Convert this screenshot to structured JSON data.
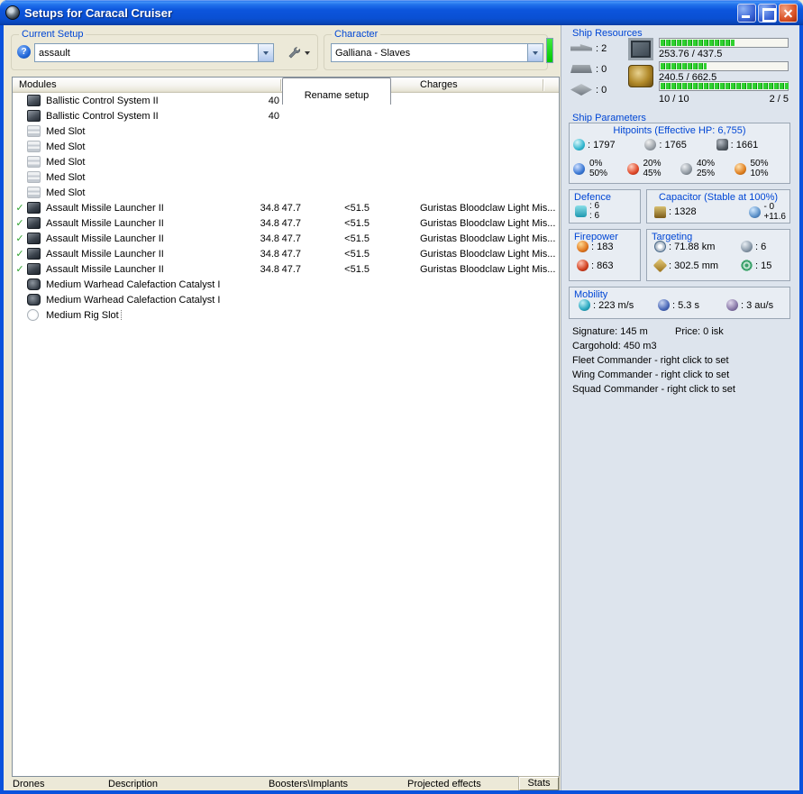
{
  "window": {
    "title": "Setups for Caracal Cruiser"
  },
  "current_setup": {
    "label": "Current Setup",
    "help_glyph": "?",
    "value": "assault"
  },
  "character": {
    "label": "Character",
    "value": "Galliana - Slaves"
  },
  "ship_resources": {
    "label": "Ship Resources",
    "hardpoints": [
      {
        "type": "turret",
        "value": ": 2"
      },
      {
        "type": "launcher",
        "value": ": 0"
      },
      {
        "type": "rig",
        "value": ": 0"
      }
    ],
    "cpu": {
      "text": "253.76 / 437.5",
      "fill": "width:58%"
    },
    "powergrid": {
      "text": "240.5 / 662.5",
      "fill": "width:36%"
    },
    "calibration": {
      "text": "10 / 10",
      "fill": "width:100%"
    },
    "drones": {
      "text": "2 / 5"
    }
  },
  "modules": {
    "column_header": "Modules",
    "tab_rename": "Rename setup",
    "tab_charges": "Charges",
    "rows": [
      {
        "check": "",
        "icon": "i-filled",
        "name": "Ballistic Control System II",
        "v1": "40",
        "v2": "",
        "v3": "",
        "charge": "",
        "row_class": ""
      },
      {
        "check": "",
        "icon": "i-filled",
        "name": "Ballistic Control System II",
        "v1": "40",
        "v2": "",
        "v3": "",
        "charge": "",
        "row_class": ""
      },
      {
        "check": "",
        "icon": "i-empty",
        "name": "Med Slot",
        "v1": "",
        "v2": "",
        "v3": "",
        "charge": "",
        "row_class": ""
      },
      {
        "check": "",
        "icon": "i-empty",
        "name": "Med Slot",
        "v1": "",
        "v2": "",
        "v3": "",
        "charge": "",
        "row_class": ""
      },
      {
        "check": "",
        "icon": "i-empty",
        "name": "Med Slot",
        "v1": "",
        "v2": "",
        "v3": "",
        "charge": "",
        "row_class": ""
      },
      {
        "check": "",
        "icon": "i-empty",
        "name": "Med Slot",
        "v1": "",
        "v2": "",
        "v3": "",
        "charge": "",
        "row_class": ""
      },
      {
        "check": "",
        "icon": "i-empty",
        "name": "Med Slot",
        "v1": "",
        "v2": "",
        "v3": "",
        "charge": "",
        "row_class": ""
      },
      {
        "check": "✓",
        "icon": "i-launcher",
        "name": "Assault Missile Launcher II",
        "v1": "34.8",
        "v2": "47.7",
        "v3": "<51.5",
        "charge": "Guristas Bloodclaw Light Mis...",
        "row_class": ""
      },
      {
        "check": "✓",
        "icon": "i-launcher",
        "name": "Assault Missile Launcher II",
        "v1": "34.8",
        "v2": "47.7",
        "v3": "<51.5",
        "charge": "Guristas Bloodclaw Light Mis...",
        "row_class": ""
      },
      {
        "check": "✓",
        "icon": "i-launcher",
        "name": "Assault Missile Launcher II",
        "v1": "34.8",
        "v2": "47.7",
        "v3": "<51.5",
        "charge": "Guristas Bloodclaw Light Mis...",
        "row_class": ""
      },
      {
        "check": "✓",
        "icon": "i-launcher",
        "name": "Assault Missile Launcher II",
        "v1": "34.8",
        "v2": "47.7",
        "v3": "<51.5",
        "charge": "Guristas Bloodclaw Light Mis...",
        "row_class": ""
      },
      {
        "check": "✓",
        "icon": "i-launcher",
        "name": "Assault Missile Launcher II",
        "v1": "34.8",
        "v2": "47.7",
        "v3": "<51.5",
        "charge": "Guristas Bloodclaw Light Mis...",
        "row_class": ""
      },
      {
        "check": "",
        "icon": "i-rig",
        "name": "Medium Warhead Calefaction Catalyst I",
        "v1": "",
        "v2": "",
        "v3": "",
        "charge": "",
        "row_class": ""
      },
      {
        "check": "",
        "icon": "i-rig",
        "name": "Medium Warhead Calefaction Catalyst I",
        "v1": "",
        "v2": "",
        "v3": "",
        "charge": "",
        "row_class": ""
      },
      {
        "check": "",
        "icon": "i-rigslot",
        "name": "Medium Rig Slot",
        "v1": "",
        "v2": "",
        "v3": "",
        "charge": "",
        "row_class": "sel"
      }
    ]
  },
  "ship_parameters": {
    "label": "Ship Parameters",
    "hitpoints": {
      "title": "Hitpoints (Effective HP: 6,755)",
      "shield": ": 1797",
      "armor": ": 1765",
      "structure": ": 1661",
      "resists": [
        {
          "type": "em",
          "top": "0%",
          "bottom": "50%"
        },
        {
          "type": "thermal",
          "top": "20%",
          "bottom": "45%"
        },
        {
          "type": "kinetic",
          "top": "40%",
          "bottom": "25%"
        },
        {
          "type": "explosive",
          "top": "50%",
          "bottom": "10%"
        }
      ]
    },
    "defence": {
      "title": "Defence",
      "line1": ": 6",
      "line2": ": 6"
    },
    "capacitor": {
      "title": "Capacitor (Stable at 100%)",
      "amount": ": 1328",
      "delta_minus": "- 0",
      "delta_plus": "+11.6"
    },
    "firepower": {
      "title": "Firepower",
      "dps": ": 183",
      "volley": ": 863"
    },
    "targeting": {
      "title": "Targeting",
      "range": ": 71.88 km",
      "max_targets": ": 6",
      "scan_resolution": ": 302.5 mm",
      "sensor_strength": ": 15"
    },
    "mobility": {
      "title": "Mobility",
      "speed": ": 223 m/s",
      "agility": ": 5.3 s",
      "warp_speed": ": 3 au/s"
    },
    "footer": {
      "signature": "Signature: 145 m",
      "price": "Price: 0 isk",
      "cargohold": "Cargohold: 450 m3",
      "fleet": "Fleet Commander - right click to set",
      "wing": "Wing Commander - right click to set",
      "squad": "Squad Commander - right click to set"
    }
  },
  "bottom_tabs": [
    {
      "label": "Drones",
      "cls": "t-drones"
    },
    {
      "label": "Description",
      "cls": "t-desc"
    },
    {
      "label": "Boosters\\Implants",
      "cls": "t-boost"
    },
    {
      "label": "Projected effects",
      "cls": "t-proj"
    },
    {
      "label": "Stats",
      "cls": "t-stats"
    }
  ]
}
